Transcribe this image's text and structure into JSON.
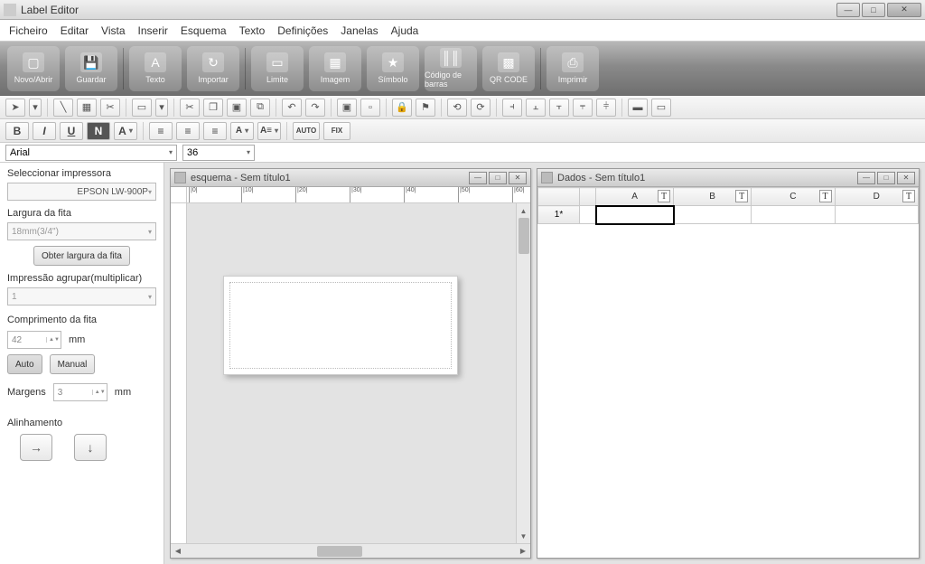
{
  "app": {
    "title": "Label Editor"
  },
  "menu": [
    "Ficheiro",
    "Editar",
    "Vista",
    "Inserir",
    "Esquema",
    "Texto",
    "Definições",
    "Janelas",
    "Ajuda"
  ],
  "bigToolbar": {
    "newOpen": "Novo/Abrir",
    "save": "Guardar",
    "text": "Texto",
    "import": "Importar",
    "border": "Limite",
    "image": "Imagem",
    "symbol": "Símbolo",
    "barcode": "Código de barras",
    "qr": "QR CODE",
    "print": "Imprimir"
  },
  "formatBar": {
    "font": "Arial",
    "size": "36",
    "auto": "AUTO",
    "fix": "FIX"
  },
  "sidebar": {
    "selectPrinter": "Seleccionar impressora",
    "printer": "EPSON LW-900P",
    "tapeWidthLabel": "Largura da fita",
    "tapeWidth": "18mm(3/4\")",
    "getTapeWidth": "Obter largura da fita",
    "groupPrintLabel": "Impressão agrupar(multiplicar)",
    "groupPrint": "1",
    "tapeLengthLabel": "Comprimento da fita",
    "tapeLength": "42",
    "mm": "mm",
    "auto": "Auto",
    "manual": "Manual",
    "marginsLabel": "Margens",
    "margins": "3",
    "alignmentLabel": "Alinhamento"
  },
  "subLeft": {
    "title": "esquema  - Sem título1"
  },
  "subRight": {
    "title": "Dados  - Sem título1",
    "cols": [
      "A",
      "B",
      "C",
      "D"
    ],
    "row1": "1*"
  },
  "rulerTicks": [
    "|0|",
    "|10|",
    "|20|",
    "|30|",
    "|40|",
    "|50|",
    "|60|"
  ]
}
